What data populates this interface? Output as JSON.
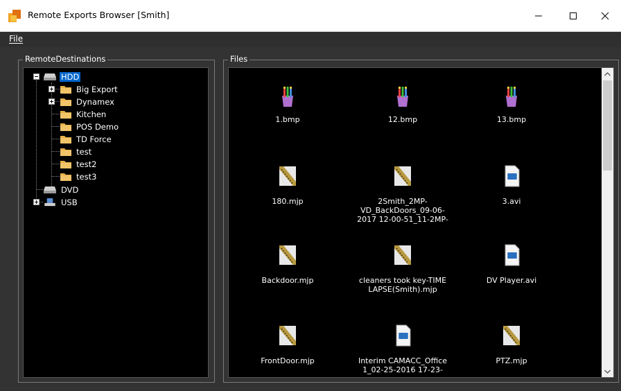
{
  "window": {
    "title": "Remote Exports Browser [Smith]"
  },
  "menu": {
    "file_label": "File"
  },
  "left_panel": {
    "title": "RemoteDestinations",
    "tree": [
      {
        "label": "HDD",
        "icon": "drive-icon",
        "selected": true,
        "expanded": true
      },
      {
        "label": "Big Export",
        "icon": "folder-icon",
        "expandable": true
      },
      {
        "label": "Dynamex",
        "icon": "folder-icon",
        "expandable": true
      },
      {
        "label": "Kitchen",
        "icon": "folder-icon"
      },
      {
        "label": "POS Demo",
        "icon": "folder-icon"
      },
      {
        "label": "TD Force",
        "icon": "folder-icon"
      },
      {
        "label": "test",
        "icon": "folder-icon"
      },
      {
        "label": "test2",
        "icon": "folder-icon"
      },
      {
        "label": "test3",
        "icon": "folder-icon"
      },
      {
        "label": "DVD",
        "icon": "drive-icon"
      },
      {
        "label": "USB",
        "icon": "usb-drive-icon",
        "expandable": true
      }
    ]
  },
  "right_panel": {
    "title": "Files",
    "files": [
      {
        "name": "1.bmp",
        "icon": "paint-brushes-icon"
      },
      {
        "name": "12.bmp",
        "icon": "paint-brushes-icon"
      },
      {
        "name": "13.bmp",
        "icon": "paint-brushes-icon"
      },
      {
        "name": "180.mjp",
        "icon": "film-reel-icon"
      },
      {
        "name": "2Smith_2MP-\nVD_BackDoors_09-06-\n2017 12-00-51_11-2MP-",
        "icon": "film-reel-icon"
      },
      {
        "name": "3.avi",
        "icon": "video-file-icon"
      },
      {
        "name": "Backdoor.mjp",
        "icon": "film-reel-icon"
      },
      {
        "name": "cleaners took key-TIME\nLAPSE(Smith).mjp",
        "icon": "film-reel-icon"
      },
      {
        "name": "DV Player.avi",
        "icon": "video-file-icon"
      },
      {
        "name": "FrontDoor.mjp",
        "icon": "film-reel-icon"
      },
      {
        "name": "Interim CAMACC_Office\n1_02-25-2016 17-23-",
        "icon": "video-file-icon"
      },
      {
        "name": "PTZ.mjp",
        "icon": "film-reel-icon"
      }
    ]
  },
  "colors": {
    "selection": "#0066cc",
    "panel_bg": "#000000",
    "window_bg": "#333333",
    "folder": "#e8b04a"
  }
}
